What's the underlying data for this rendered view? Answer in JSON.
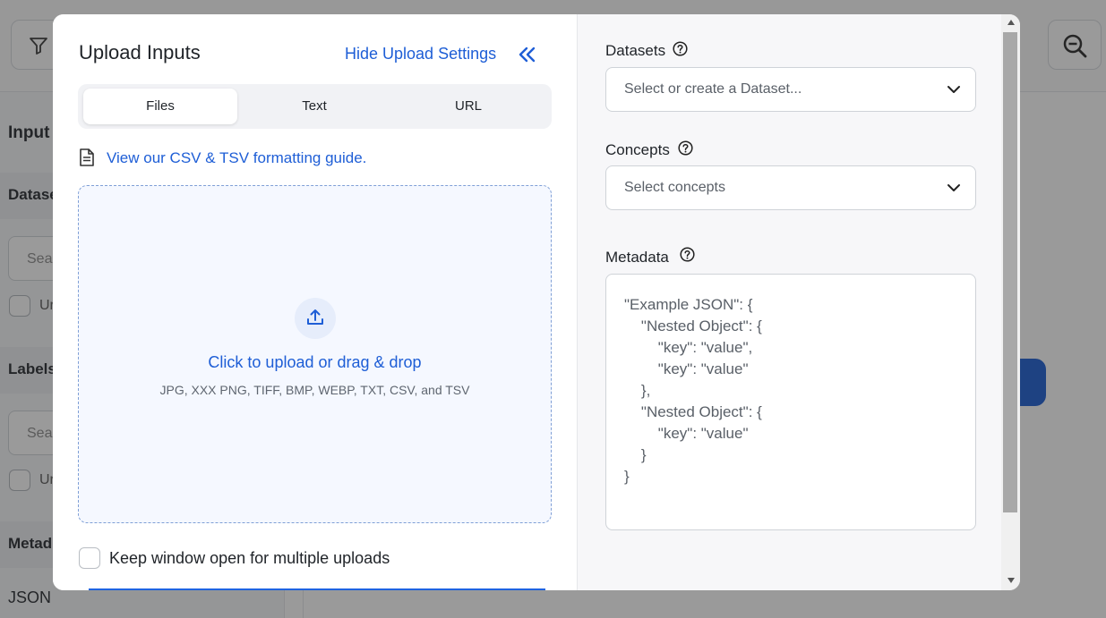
{
  "background": {
    "sidebar_heading": "Input",
    "sections": [
      "Datase",
      "Labels",
      "Metad"
    ],
    "search_placeholder": "Sear",
    "checkbox_label": "Ur",
    "json_label": "JSON"
  },
  "modal": {
    "title": "Upload Inputs",
    "hide_settings": "Hide Upload Settings",
    "tabs": [
      "Files",
      "Text",
      "URL"
    ],
    "active_tab": "Files",
    "guide_link": "View our CSV & TSV formatting guide.",
    "dropzone": {
      "main": "Click to upload or drag & drop",
      "formats": "JPG, XXX PNG, TIFF, BMP, WEBP, TXT, CSV, and TSV"
    },
    "keep_open_label": "Keep window open for multiple uploads"
  },
  "settings": {
    "datasets": {
      "label": "Datasets",
      "placeholder": "Select or create a Dataset..."
    },
    "concepts": {
      "label": "Concepts",
      "placeholder": "Select concepts"
    },
    "metadata": {
      "label": "Metadata",
      "placeholder": "\"Example JSON\": {\n\t\"Nested Object\": {\n\t\t\"key\": \"value\",\n\t\t\"key\": \"value\"\n\t},\n\t\"Nested Object\": {\n\t\t\"key\": \"value\"\n\t}\n}"
    }
  },
  "colors": {
    "accent": "#1e5ed6",
    "overlay": "#8f8f8f",
    "dropzone_bg": "#f5f8ff"
  }
}
